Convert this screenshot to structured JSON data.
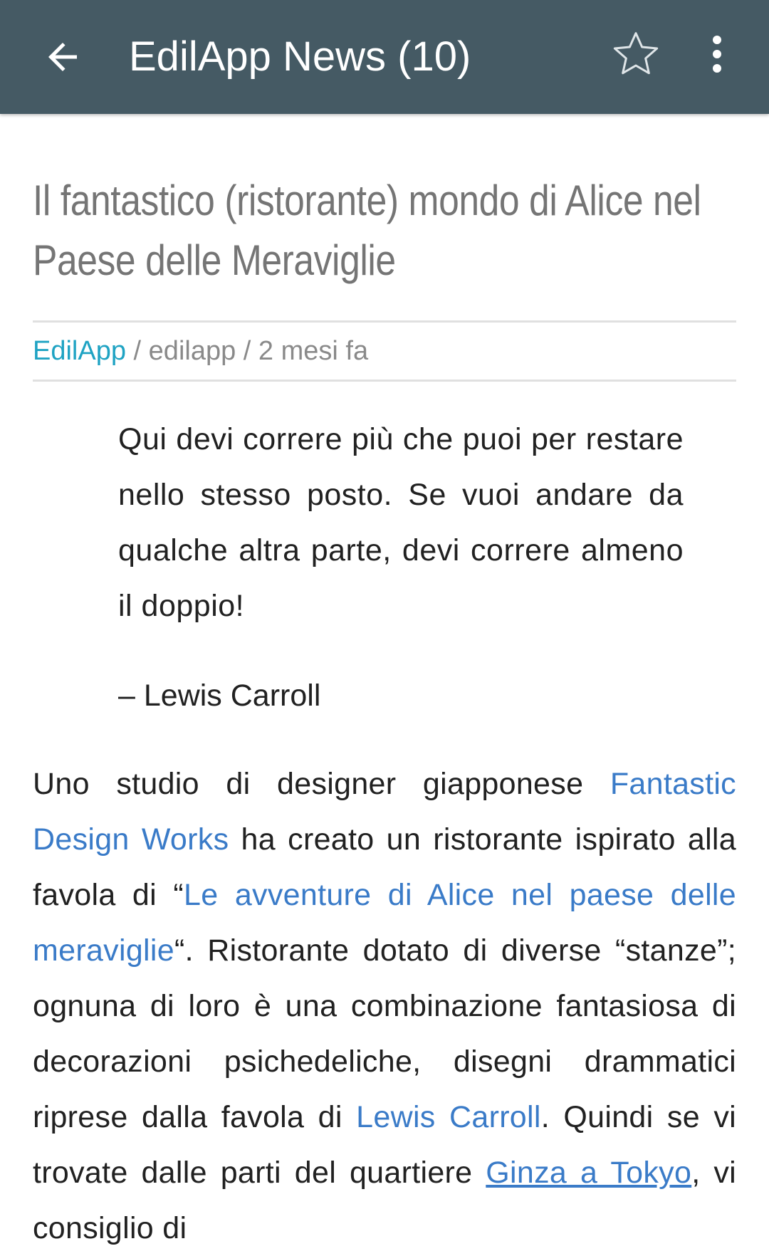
{
  "appbar": {
    "title": "EdilApp News (10)",
    "back_icon": "arrow-back-icon",
    "star_icon": "star-outline-icon",
    "more_icon": "more-vert-icon",
    "background_color": "#455a64"
  },
  "article": {
    "title": "Il fantastico (ristorante) mondo di Alice nel Paese delle Meraviglie",
    "meta": {
      "source": "EdilApp",
      "separator1": " / ",
      "author": "edilapp",
      "separator2": " / ",
      "time": "2 mesi fa"
    },
    "quote": "Qui devi correre più che puoi per restare nello stesso posto. Se vuoi andare da qualche altra parte, devi correre almeno il doppio!",
    "attribution": "– Lewis Carroll",
    "body": {
      "t1": "Uno studio di designer giapponese ",
      "link1": "Fantastic Design Works",
      "t2": " ha creato un ristorante ispirato alla favola di “",
      "link2": "Le avventure di Alice nel paese delle meraviglie",
      "t3": "“.  Ristorante dotato di diverse “stanze”; ognuna di loro è una combinazione fantasiosa di decorazioni psichedeliche, disegni drammatici riprese dalla favola di ",
      "link3": "Lewis Carroll",
      "t4": ". Quindi se vi trovate dalle parti del quartiere ",
      "link4": "Ginza a Tokyo",
      "t5": ", vi consiglio di"
    },
    "link_color": "#3a7bc8",
    "source_color": "#1fa3c3"
  }
}
